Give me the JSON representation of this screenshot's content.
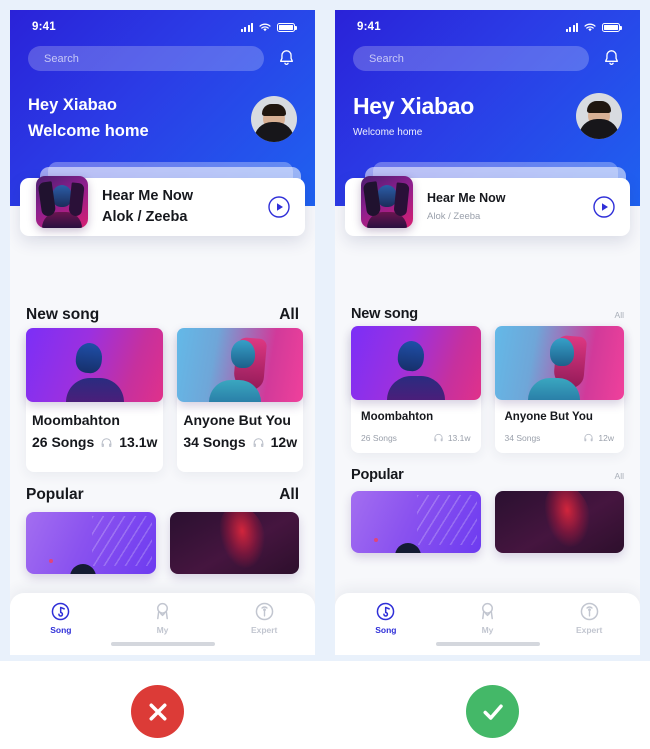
{
  "meta": {
    "accent_blue": "#2f2fd8",
    "hero_gradient_from": "#2a22d8",
    "hero_gradient_to": "#1f62f0",
    "bad_color": "#dc3b37",
    "good_color": "#44b868"
  },
  "status_bar": {
    "time": "9:41",
    "icons": [
      "signal-icon",
      "wifi-icon",
      "battery-icon"
    ]
  },
  "search": {
    "placeholder": "Search",
    "value": ""
  },
  "greeting": {
    "line1": "Hey Xiabao",
    "line2": "Welcome home"
  },
  "now_playing": {
    "title": "Hear Me Now",
    "artist": "Alok / Zeeba",
    "play_label": "play-icon"
  },
  "sections": [
    {
      "title": "New song",
      "all_label": "All",
      "cards": [
        {
          "title": "Moombahton",
          "songs": "26 Songs",
          "plays": "13.1w"
        },
        {
          "title": "Anyone But You",
          "songs": "34 Songs",
          "plays": "12w"
        }
      ]
    },
    {
      "title": "Popular",
      "all_label": "All",
      "cards": []
    }
  ],
  "tabbar": [
    {
      "label": "Song",
      "icon": "music-note-icon",
      "active": true
    },
    {
      "label": "My",
      "icon": "person-icon",
      "active": false
    },
    {
      "label": "Expert",
      "icon": "broadcast-icon",
      "active": false
    }
  ],
  "verdicts": {
    "bad": "cross-icon",
    "good": "check-icon"
  }
}
